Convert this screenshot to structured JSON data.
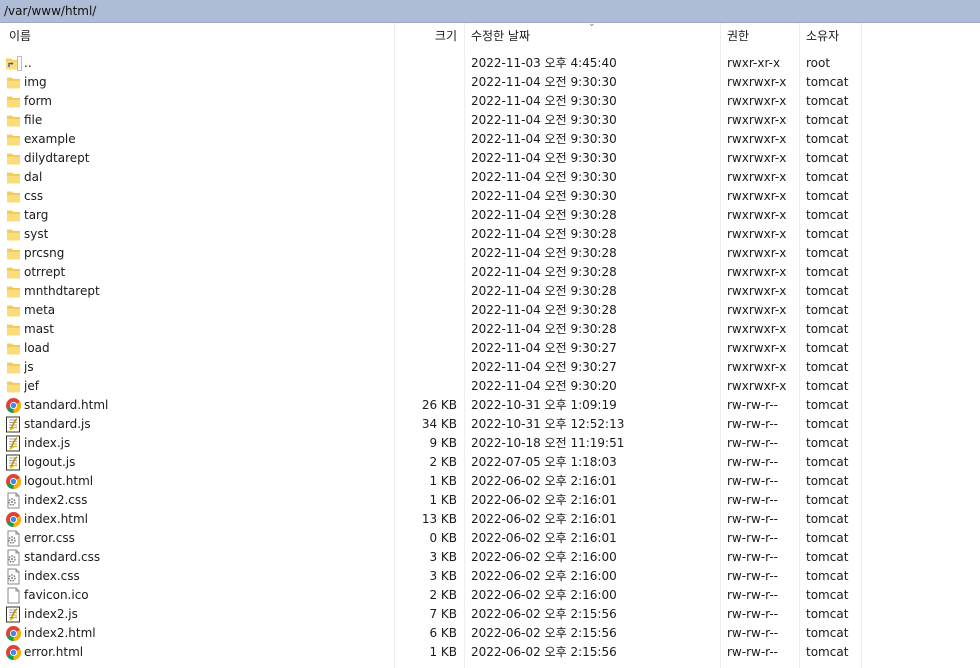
{
  "path": "/var/www/html/",
  "columns": {
    "name": "이름",
    "size": "크기",
    "modified": "수정한 날짜",
    "permissions": "권한",
    "owner": "소유자"
  },
  "files": [
    {
      "icon": "parent-folder-icon",
      "name": "..",
      "size": "",
      "modified": "2022-11-03 오후 4:45:40",
      "permissions": "rwxr-xr-x",
      "owner": "root"
    },
    {
      "icon": "folder-icon",
      "name": "img",
      "size": "",
      "modified": "2022-11-04 오전 9:30:30",
      "permissions": "rwxrwxr-x",
      "owner": "tomcat"
    },
    {
      "icon": "folder-icon",
      "name": "form",
      "size": "",
      "modified": "2022-11-04 오전 9:30:30",
      "permissions": "rwxrwxr-x",
      "owner": "tomcat"
    },
    {
      "icon": "folder-icon",
      "name": "file",
      "size": "",
      "modified": "2022-11-04 오전 9:30:30",
      "permissions": "rwxrwxr-x",
      "owner": "tomcat"
    },
    {
      "icon": "folder-icon",
      "name": "example",
      "size": "",
      "modified": "2022-11-04 오전 9:30:30",
      "permissions": "rwxrwxr-x",
      "owner": "tomcat"
    },
    {
      "icon": "folder-icon",
      "name": "dilydtarept",
      "size": "",
      "modified": "2022-11-04 오전 9:30:30",
      "permissions": "rwxrwxr-x",
      "owner": "tomcat"
    },
    {
      "icon": "folder-icon",
      "name": "dal",
      "size": "",
      "modified": "2022-11-04 오전 9:30:30",
      "permissions": "rwxrwxr-x",
      "owner": "tomcat"
    },
    {
      "icon": "folder-icon",
      "name": "css",
      "size": "",
      "modified": "2022-11-04 오전 9:30:30",
      "permissions": "rwxrwxr-x",
      "owner": "tomcat"
    },
    {
      "icon": "folder-icon",
      "name": "targ",
      "size": "",
      "modified": "2022-11-04 오전 9:30:28",
      "permissions": "rwxrwxr-x",
      "owner": "tomcat"
    },
    {
      "icon": "folder-icon",
      "name": "syst",
      "size": "",
      "modified": "2022-11-04 오전 9:30:28",
      "permissions": "rwxrwxr-x",
      "owner": "tomcat"
    },
    {
      "icon": "folder-icon",
      "name": "prcsng",
      "size": "",
      "modified": "2022-11-04 오전 9:30:28",
      "permissions": "rwxrwxr-x",
      "owner": "tomcat"
    },
    {
      "icon": "folder-icon",
      "name": "otrrept",
      "size": "",
      "modified": "2022-11-04 오전 9:30:28",
      "permissions": "rwxrwxr-x",
      "owner": "tomcat"
    },
    {
      "icon": "folder-icon",
      "name": "mnthdtarept",
      "size": "",
      "modified": "2022-11-04 오전 9:30:28",
      "permissions": "rwxrwxr-x",
      "owner": "tomcat"
    },
    {
      "icon": "folder-icon",
      "name": "meta",
      "size": "",
      "modified": "2022-11-04 오전 9:30:28",
      "permissions": "rwxrwxr-x",
      "owner": "tomcat"
    },
    {
      "icon": "folder-icon",
      "name": "mast",
      "size": "",
      "modified": "2022-11-04 오전 9:30:28",
      "permissions": "rwxrwxr-x",
      "owner": "tomcat"
    },
    {
      "icon": "folder-icon",
      "name": "load",
      "size": "",
      "modified": "2022-11-04 오전 9:30:27",
      "permissions": "rwxrwxr-x",
      "owner": "tomcat"
    },
    {
      "icon": "folder-icon",
      "name": "js",
      "size": "",
      "modified": "2022-11-04 오전 9:30:27",
      "permissions": "rwxrwxr-x",
      "owner": "tomcat"
    },
    {
      "icon": "folder-icon",
      "name": "jef",
      "size": "",
      "modified": "2022-11-04 오전 9:30:20",
      "permissions": "rwxrwxr-x",
      "owner": "tomcat"
    },
    {
      "icon": "chrome-html-icon",
      "name": "standard.html",
      "size": "26 KB",
      "modified": "2022-10-31 오후 1:09:19",
      "permissions": "rw-rw-r--",
      "owner": "tomcat"
    },
    {
      "icon": "script-file-icon",
      "name": "standard.js",
      "size": "34 KB",
      "modified": "2022-10-31 오후 12:52:13",
      "permissions": "rw-rw-r--",
      "owner": "tomcat"
    },
    {
      "icon": "script-file-icon",
      "name": "index.js",
      "size": "9 KB",
      "modified": "2022-10-18 오전 11:19:51",
      "permissions": "rw-rw-r--",
      "owner": "tomcat"
    },
    {
      "icon": "script-file-icon",
      "name": "logout.js",
      "size": "2 KB",
      "modified": "2022-07-05 오후 1:18:03",
      "permissions": "rw-rw-r--",
      "owner": "tomcat"
    },
    {
      "icon": "chrome-html-icon",
      "name": "logout.html",
      "size": "1 KB",
      "modified": "2022-06-02 오후 2:16:01",
      "permissions": "rw-rw-r--",
      "owner": "tomcat"
    },
    {
      "icon": "css-file-icon",
      "name": "index2.css",
      "size": "1 KB",
      "modified": "2022-06-02 오후 2:16:01",
      "permissions": "rw-rw-r--",
      "owner": "tomcat"
    },
    {
      "icon": "chrome-html-icon",
      "name": "index.html",
      "size": "13 KB",
      "modified": "2022-06-02 오후 2:16:01",
      "permissions": "rw-rw-r--",
      "owner": "tomcat"
    },
    {
      "icon": "css-file-icon",
      "name": "error.css",
      "size": "0 KB",
      "modified": "2022-06-02 오후 2:16:01",
      "permissions": "rw-rw-r--",
      "owner": "tomcat"
    },
    {
      "icon": "css-file-icon",
      "name": "standard.css",
      "size": "3 KB",
      "modified": "2022-06-02 오후 2:16:00",
      "permissions": "rw-rw-r--",
      "owner": "tomcat"
    },
    {
      "icon": "css-file-icon",
      "name": "index.css",
      "size": "3 KB",
      "modified": "2022-06-02 오후 2:16:00",
      "permissions": "rw-rw-r--",
      "owner": "tomcat"
    },
    {
      "icon": "blank-file-icon",
      "name": "favicon.ico",
      "size": "2 KB",
      "modified": "2022-06-02 오후 2:16:00",
      "permissions": "rw-rw-r--",
      "owner": "tomcat"
    },
    {
      "icon": "script-file-icon",
      "name": "index2.js",
      "size": "7 KB",
      "modified": "2022-06-02 오후 2:15:56",
      "permissions": "rw-rw-r--",
      "owner": "tomcat"
    },
    {
      "icon": "chrome-html-icon",
      "name": "index2.html",
      "size": "6 KB",
      "modified": "2022-06-02 오후 2:15:56",
      "permissions": "rw-rw-r--",
      "owner": "tomcat"
    },
    {
      "icon": "chrome-html-icon",
      "name": "error.html",
      "size": "1 KB",
      "modified": "2022-06-02 오후 2:15:56",
      "permissions": "rw-rw-r--",
      "owner": "tomcat"
    }
  ]
}
